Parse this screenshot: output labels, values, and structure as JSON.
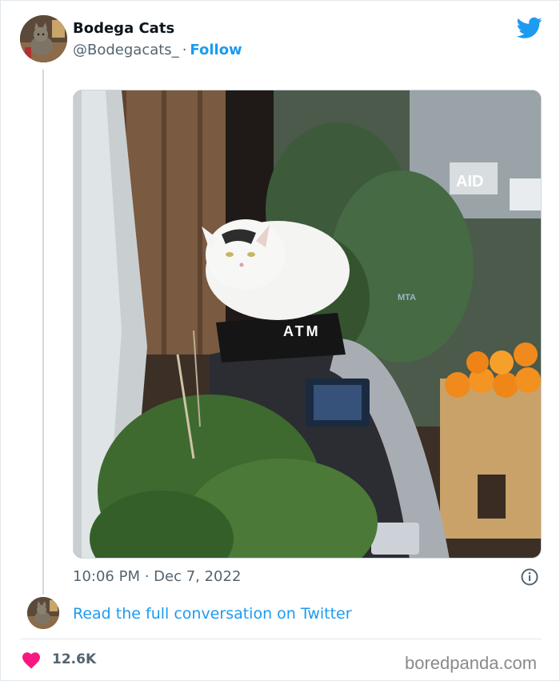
{
  "tweet": {
    "author_name": "Bodega Cats",
    "author_handle": "@Bodegacats_",
    "separator": "·",
    "follow_label": "Follow",
    "timestamp": "10:06 PM · Dec 7, 2022",
    "read_conversation_label": "Read the full conversation on Twitter",
    "like_count": "12.6K",
    "photo_signs": {
      "atm": "ATM",
      "aid": "AID",
      "mta": "MTA"
    }
  },
  "watermark": "boredpanda.com",
  "colors": {
    "link_blue": "#1d9bf0",
    "heart_pink": "#f91880",
    "secondary_text": "#536471"
  },
  "icons": {
    "brand": "twitter-bird-icon",
    "info": "info-circle-icon",
    "like": "heart-icon"
  }
}
